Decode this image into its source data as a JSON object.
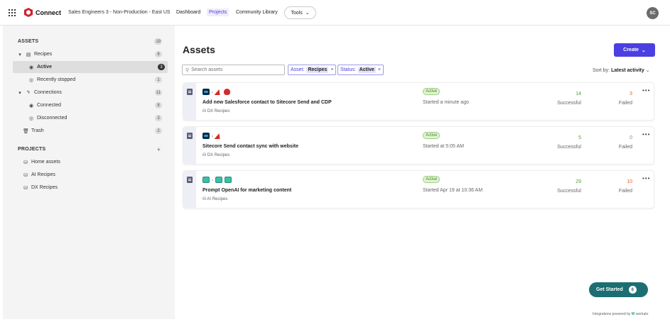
{
  "topbar": {
    "app_title": "Connect",
    "environment": "Sales Engineers 3 - Non-Production - East US",
    "nav": [
      "Dashboard",
      "Projects",
      "Community Library"
    ],
    "active_nav": "Projects",
    "tools_label": "Tools",
    "user_initials": "SC"
  },
  "sidebar": {
    "assets_header": "ASSETS",
    "assets_count": "19",
    "recipes_label": "Recipes",
    "recipes_count": "8",
    "active_label": "Active",
    "active_count": "3",
    "recently_stopped_label": "Recently stopped",
    "recently_stopped_count": "1",
    "connections_label": "Connections",
    "connections_count": "11",
    "connected_label": "Connected",
    "connected_count": "8",
    "disconnected_label": "Disconnected",
    "disconnected_count": "3",
    "trash_label": "Trash",
    "trash_count": "2",
    "projects_header": "PROJECTS",
    "projects": [
      "Home assets",
      "AI Recipes",
      "DX Recipes"
    ]
  },
  "main": {
    "title": "Assets",
    "create_label": "Create",
    "search_placeholder": "Search assets",
    "filter_asset_label": "Asset:",
    "filter_asset_value": "Recipes",
    "filter_status_label": "Status:",
    "filter_status_value": "Active",
    "sort_label": "Sort by:",
    "sort_value": "Latest activity",
    "success_label": "Successful",
    "failed_label": "Failed"
  },
  "recipes": [
    {
      "name": "Add new Salesforce contact to Sitecore Send and CDP",
      "project": "DX Recipes",
      "status": "Active",
      "started": "Started a minute ago",
      "successful": "14",
      "failed": "3",
      "apps": [
        "sitecore-icon",
        "red-app-icon",
        "red-shield-icon"
      ]
    },
    {
      "name": "Sitecore Send contact sync with website",
      "project": "DX Recipes",
      "status": "Active",
      "started": "Started at 5:05 AM",
      "successful": "5",
      "failed": "0",
      "apps": [
        "sitecore-icon",
        "red-app-icon"
      ]
    },
    {
      "name": "Prompt OpenAI for marketing content",
      "project": "AI Recipes",
      "status": "Active",
      "started": "Started Apr 19 at 10:36 AM",
      "successful": "29",
      "failed": "10",
      "apps": [
        "teal-app-icon",
        "teal-app-icon",
        "teal-app-icon"
      ]
    }
  ],
  "footer": {
    "get_started_label": "Get Started",
    "get_started_count": "6",
    "powered_by": "Integrations powered by",
    "brand": "workato"
  },
  "colors": {
    "accent": "#4a3fe0",
    "success": "#5a9c3a",
    "failed": "#e0612e",
    "get_started": "#1c6e73"
  }
}
